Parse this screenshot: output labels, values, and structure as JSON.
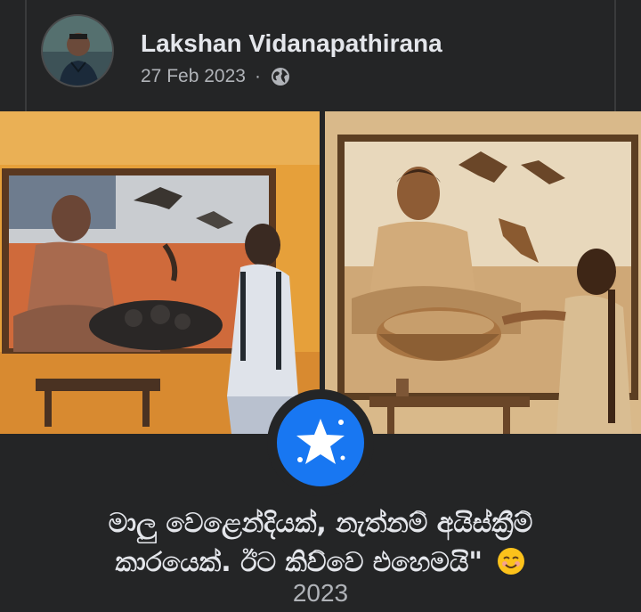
{
  "post": {
    "author": "Lakshan Vidanapathirana",
    "date": "27 Feb 2023",
    "separator": "·",
    "privacy_icon": "globe-icon"
  },
  "images": [
    {
      "description_icon": "painting-left"
    },
    {
      "description_icon": "painting-right"
    }
  ],
  "badge_icon": "star-icon",
  "caption": {
    "line1": "මාලු වෙළෙන්දියක්, නැත්නම් අයිස්ක්‍රීම්",
    "line2": "කාරයෙක්. ඊට කිව්වෙ එහෙමයි\"",
    "emoji": "smiling-face-icon",
    "year": "2023"
  },
  "colors": {
    "background": "#242526",
    "text": "#e4e6eb",
    "secondary_text": "#b0b3b8",
    "accent": "#1877f2"
  }
}
